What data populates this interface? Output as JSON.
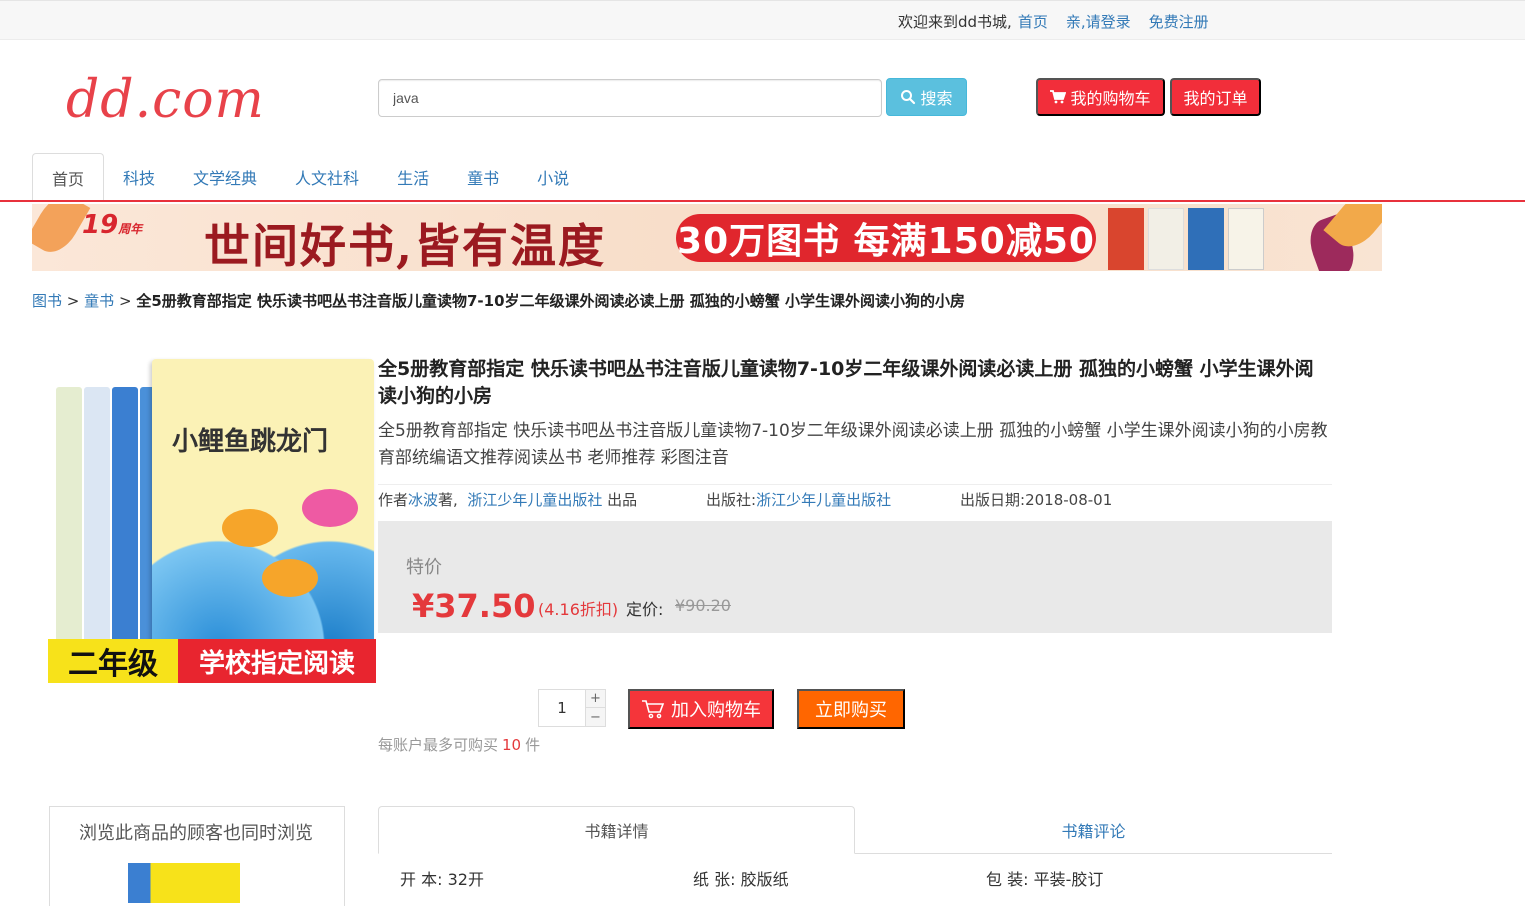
{
  "topbar": {
    "welcome": "欢迎来到dd书城,",
    "home": "首页",
    "login": "亲,请登录",
    "register": "免费注册"
  },
  "header": {
    "logo": "dd.com",
    "search_value": "java",
    "search_button": "搜索",
    "cart_button": "我的购物车",
    "orders_button": "我的订单"
  },
  "nav": {
    "tabs": [
      "首页",
      "科技",
      "文学经典",
      "人文社科",
      "生活",
      "童书",
      "小说"
    ],
    "active": "首页"
  },
  "banner": {
    "anniversary": "19",
    "anniversary_suffix": "周年",
    "slogan": "世间好书,皆有温度",
    "promo": "30万图书 每满150减50"
  },
  "breadcrumb": {
    "root": "图书",
    "category": "童书",
    "separator": ">",
    "current": "全5册教育部指定 快乐读书吧丛书注音版儿童读物7-10岁二年级课外阅读必读上册 孤独的小螃蟹 小学生课外阅读小狗的小房"
  },
  "cover": {
    "title": "小鲤鱼跳龙门",
    "grade": "二年级",
    "tagline": "学校指定阅读"
  },
  "product": {
    "title": "全5册教育部指定 快乐读书吧丛书注音版儿童读物7-10岁二年级课外阅读必读上册 孤独的小螃蟹 小学生课外阅读小狗的小房",
    "subtitle": "全5册教育部指定 快乐读书吧丛书注音版儿童读物7-10岁二年级课外阅读必读上册 孤独的小螃蟹 小学生课外阅读小狗的小房教育部统编语文推荐阅读丛书 老师推荐 彩图注音",
    "author_label": "作者",
    "author": "冰波",
    "author_suffix": "著,",
    "producer": "浙江少年儿童出版社",
    "producer_suffix": "出品",
    "publisher_label": "出版社:",
    "publisher": "浙江少年儿童出版社",
    "date_label": "出版日期:",
    "date": "2018-08-01"
  },
  "price": {
    "label": "特价",
    "current": "¥37.50",
    "discount": "(4.16折扣)",
    "original_label": "定价:",
    "original": "¥90.20"
  },
  "purchase": {
    "quantity": "1",
    "plus": "+",
    "minus": "−",
    "add_to_cart": "加入购物车",
    "buy_now": "立即购买",
    "limit_prefix": "每账户最多可购买",
    "limit_count": "10",
    "limit_suffix": "件"
  },
  "also_viewed": {
    "heading": "浏览此商品的顾客也同时浏览"
  },
  "detail_tabs": {
    "details": "书籍详情",
    "reviews": "书籍评论"
  },
  "specs": [
    {
      "label": "开 本:",
      "value": "32开"
    },
    {
      "label": "纸 张:",
      "value": "胶版纸"
    },
    {
      "label": "包 装:",
      "value": "平装-胶订"
    }
  ],
  "colors": {
    "brand_red": "#e8424a",
    "accent_red": "#f22e3a",
    "search_blue": "#5bc0de",
    "buy_orange": "#ff6600",
    "link_blue": "#337ab7"
  }
}
